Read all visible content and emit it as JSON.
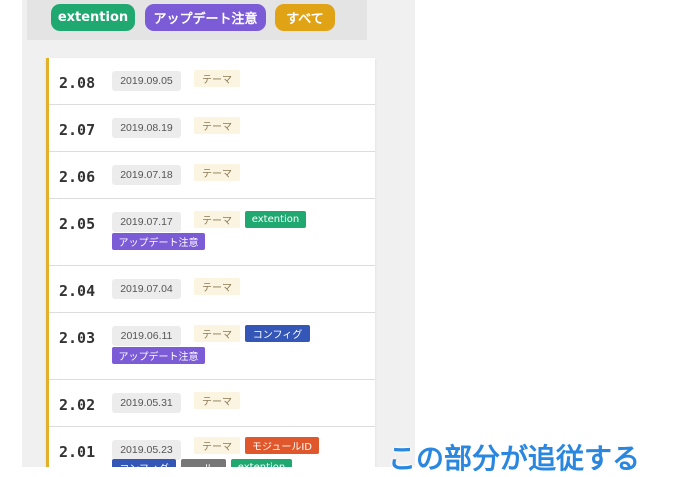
{
  "filters": {
    "extention": "extention",
    "update": "アップデート注意",
    "all": "すべて"
  },
  "colors": {
    "extention": "#1fa971",
    "update": "#7b5bd6",
    "all": "#e1a316",
    "accent_border": "#e1b12c",
    "caption": "#2a87e0"
  },
  "changelog": [
    {
      "version": "2.08",
      "date": "2019.09.05",
      "tags": [
        "テーマ"
      ]
    },
    {
      "version": "2.07",
      "date": "2019.08.19",
      "tags": [
        "テーマ"
      ]
    },
    {
      "version": "2.06",
      "date": "2019.07.18",
      "tags": [
        "テーマ"
      ]
    },
    {
      "version": "2.05",
      "date": "2019.07.17",
      "tags": [
        "テーマ",
        "extention",
        "アップデート注意"
      ]
    },
    {
      "version": "2.04",
      "date": "2019.07.04",
      "tags": [
        "テーマ"
      ]
    },
    {
      "version": "2.03",
      "date": "2019.06.11",
      "tags": [
        "テーマ",
        "コンフィグ",
        "アップデート注意"
      ]
    },
    {
      "version": "2.02",
      "date": "2019.05.31",
      "tags": [
        "テーマ"
      ]
    },
    {
      "version": "2.01",
      "date": "2019.05.23",
      "tags": [
        "テーマ",
        "モジュールID",
        "コンフィグ",
        "ール",
        "extention"
      ]
    }
  ],
  "caption": "この部分が追従する"
}
